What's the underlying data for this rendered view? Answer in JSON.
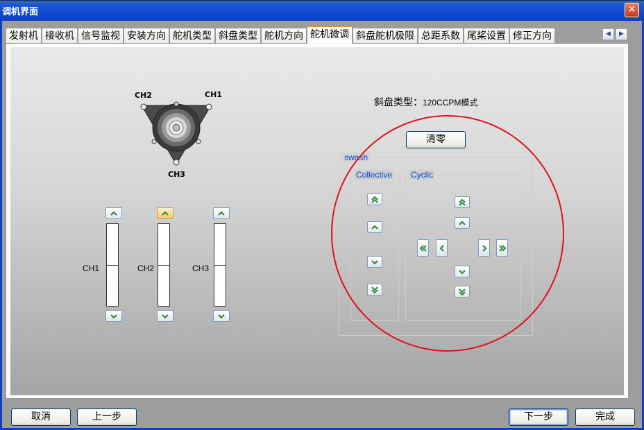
{
  "window": {
    "title": "调机界面",
    "close_glyph": "✕"
  },
  "tabs": [
    {
      "label": "发射机"
    },
    {
      "label": "接收机"
    },
    {
      "label": "信号监视"
    },
    {
      "label": "安装方向"
    },
    {
      "label": "舵机类型"
    },
    {
      "label": "斜盘类型"
    },
    {
      "label": "舵机方向"
    },
    {
      "label": "舵机微调",
      "active": true
    },
    {
      "label": "斜盘舵机极限"
    },
    {
      "label": "总距系数"
    },
    {
      "label": "尾桨设置"
    },
    {
      "label": "修正方向"
    }
  ],
  "tab_scroll": {
    "left": "◀",
    "right": "▶"
  },
  "swashplate_diagram": {
    "ch1": "CH1",
    "ch2": "CH2",
    "ch3": "CH3"
  },
  "channels": [
    {
      "label": "CH1",
      "level": 0.5
    },
    {
      "label": "CH2",
      "level": 0.5
    },
    {
      "label": "CH3",
      "level": 0.5
    }
  ],
  "swash_type": {
    "label": "斜盘类型：",
    "value": "120CCPM模式"
  },
  "reset_button": "清零",
  "swash_group": {
    "legend": "swash"
  },
  "collective_group": {
    "legend": "Collective"
  },
  "cyclic_group": {
    "legend": "Cyclic"
  },
  "footer": {
    "cancel": "取消",
    "prev": "上一步",
    "next": "下一步",
    "finish": "完成"
  },
  "colors": {
    "annotation": "#e0101a",
    "titlebar": "#1148d0",
    "arrow": "#2e8b3a"
  }
}
